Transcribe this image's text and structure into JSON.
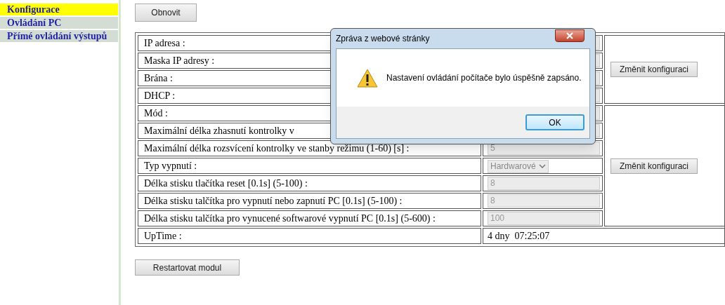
{
  "sidebar": {
    "items": [
      {
        "label": "Konfigurace",
        "selected": true
      },
      {
        "label": "Ovládání PC",
        "selected": false
      },
      {
        "label": "Přímé ovládání výstupů",
        "selected": false
      }
    ]
  },
  "refresh_button": "Obnovit",
  "groups": [
    {
      "button": "Změnit konfiguraci",
      "rows": [
        {
          "label": "IP adresa :",
          "field": {
            "kind": "input",
            "disabled": true
          }
        },
        {
          "label": "Maska IP adresy :",
          "field": {
            "kind": "input",
            "disabled": true
          }
        },
        {
          "label": "Brána :",
          "field": {
            "kind": "input",
            "disabled": true
          }
        },
        {
          "label": "DHCP :",
          "field": {
            "kind": "input",
            "disabled": true
          }
        }
      ]
    },
    {
      "button": "Změnit konfiguraci",
      "rows": [
        {
          "label": "Mód :",
          "field": {
            "kind": "input",
            "disabled": true
          }
        },
        {
          "label": "Maximální délka zhasnutí kontrolky v",
          "field": {
            "kind": "input",
            "disabled": true
          }
        },
        {
          "label": "Maximální délka rozsvícení kontrolky ve stanby režimu (1-60) [s] :",
          "field": {
            "kind": "input",
            "disabled": true,
            "value": "5"
          }
        },
        {
          "label": "Typ vypnutí :",
          "field": {
            "kind": "select",
            "disabled": true,
            "value": "Hardwarové"
          }
        },
        {
          "label": "Délka stisku tlačítka reset [0.1s] (5-100) :",
          "field": {
            "kind": "input",
            "disabled": true,
            "value": "8"
          }
        },
        {
          "label": "Délka stisku talčítka pro vypnutí nebo zapnutí PC [0.1s] (5-100) :",
          "field": {
            "kind": "input",
            "disabled": true,
            "value": "8"
          }
        },
        {
          "label": "Délka stisku talčítka pro vynucené softwarové vypnutí PC [0.1s] (5-600) :",
          "field": {
            "kind": "input",
            "disabled": true,
            "value": "100"
          }
        }
      ]
    }
  ],
  "uptime": {
    "label": "UpTime :",
    "value": "4 dny  07:25:07"
  },
  "restart_button": "Restartovat modul",
  "dialog": {
    "title": "Zpráva z webové stránky",
    "message": "Nastavení ovládání počítače bylo úspěšně zapsáno.",
    "button": "OK"
  }
}
